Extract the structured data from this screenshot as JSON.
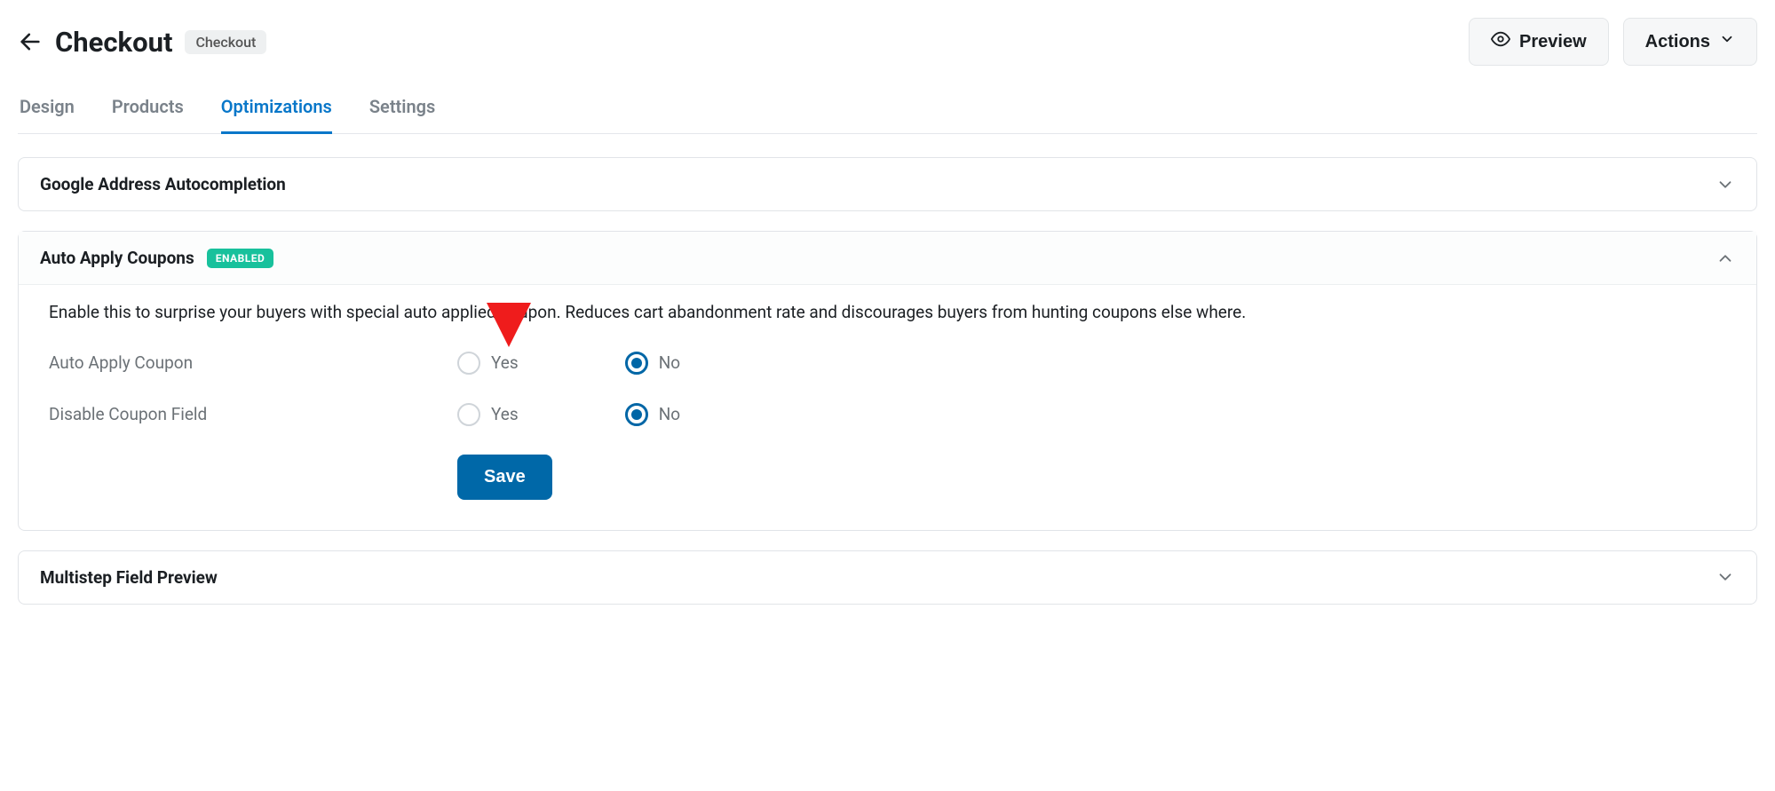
{
  "header": {
    "title": "Checkout",
    "tag": "Checkout",
    "preview_label": "Preview",
    "actions_label": "Actions"
  },
  "tabs": [
    {
      "id": "design",
      "label": "Design",
      "active": false
    },
    {
      "id": "products",
      "label": "Products",
      "active": false
    },
    {
      "id": "optimizations",
      "label": "Optimizations",
      "active": true
    },
    {
      "id": "settings",
      "label": "Settings",
      "active": false
    }
  ],
  "panels": {
    "google_address": {
      "title": "Google Address Autocompletion"
    },
    "auto_apply_coupons": {
      "title": "Auto Apply Coupons",
      "badge": "ENABLED",
      "description": "Enable this to surprise your buyers with special auto applied coupon. Reduces cart abandonment rate and discourages buyers from hunting coupons else where.",
      "fields": {
        "auto_apply_coupon": {
          "label": "Auto Apply Coupon",
          "options": {
            "yes": "Yes",
            "no": "No"
          },
          "value": "no"
        },
        "disable_coupon_field": {
          "label": "Disable Coupon Field",
          "options": {
            "yes": "Yes",
            "no": "No"
          },
          "value": "no"
        }
      },
      "save_label": "Save"
    },
    "multistep": {
      "title": "Multistep Field Preview"
    }
  }
}
